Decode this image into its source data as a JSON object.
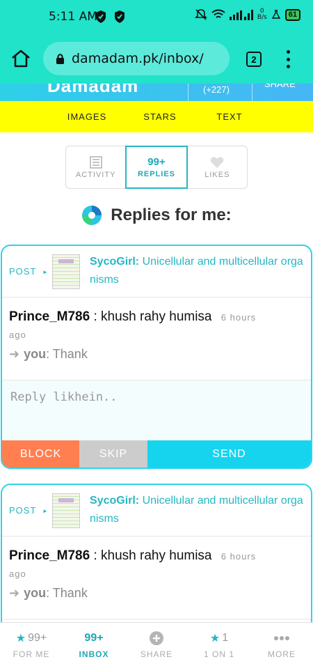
{
  "status_bar": {
    "time": "5:11 AM",
    "net_speed_value": "0",
    "net_speed_unit": "B/s",
    "battery": "61",
    "colors": {
      "bar": "#20e3c9",
      "battery": "#37c85a"
    }
  },
  "browser": {
    "url": "damadam.pk/inbox/",
    "tab_count": "2"
  },
  "site_header": {
    "logo": "Damadam",
    "count": "(+227)",
    "share": "SHARE"
  },
  "nav_links": [
    "IMAGES",
    "STARS",
    "TEXT"
  ],
  "tabs": {
    "activity": "ACTIVITY",
    "replies_count": "99+",
    "replies": "REPLIES",
    "likes": "LIKES"
  },
  "page_title": "Replies for me:",
  "cards": [
    {
      "post_label": "POST",
      "poster": "SycoGirl:",
      "post_title": "Unicellular and multicellular organisms",
      "sender": "Prince_M786",
      "separator": ":",
      "message": "khush rahy humisa",
      "time": "6 hours",
      "ago": "ago",
      "you": "you",
      "your_text": ": Thank",
      "reply_placeholder": "Reply likhein..",
      "block": "BLOCK",
      "skip": "SKIP",
      "send": "SEND"
    },
    {
      "post_label": "POST",
      "poster": "SycoGirl:",
      "post_title": "Unicellular and multicellular organisms",
      "sender": "Prince_M786",
      "separator": ":",
      "message": "khush rahy humisa",
      "time": "6 hours",
      "ago": "ago",
      "you": "you",
      "your_text": ": Thank"
    }
  ],
  "bottom_nav": [
    {
      "top": "99+",
      "label": "FOR ME",
      "icon": "star-icon"
    },
    {
      "top": "99+",
      "label": "INBOX"
    },
    {
      "label": "SHARE",
      "icon": "plus-icon"
    },
    {
      "top": "1",
      "label": "1 ON 1",
      "icon": "star-icon"
    },
    {
      "label": "MORE",
      "icon": "dots-icon"
    }
  ],
  "colors": {
    "accent": "#26b6c3",
    "card_border": "#2fd2ea",
    "block": "#ff7f50",
    "skip": "#cccccc",
    "send": "#16d4ee",
    "yellow_nav": "#ffff00"
  }
}
